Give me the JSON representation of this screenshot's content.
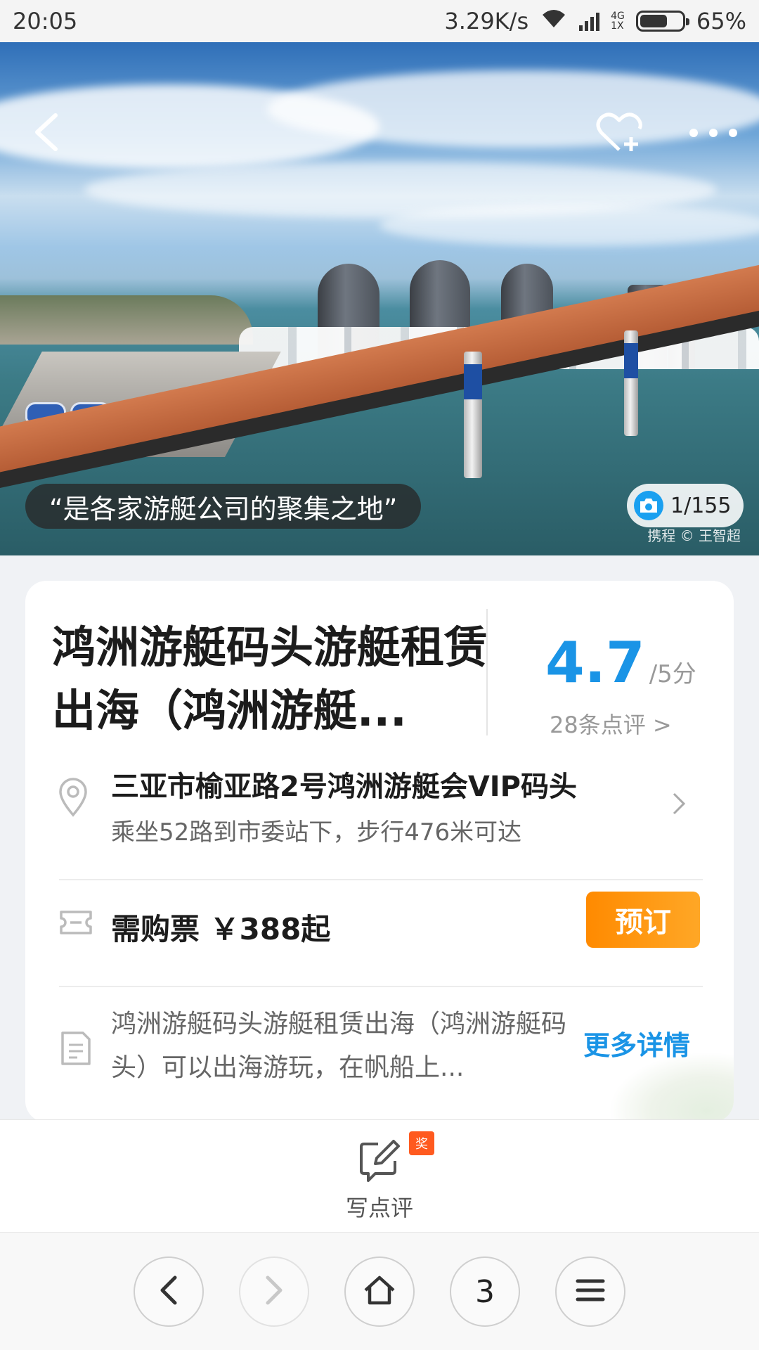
{
  "status_bar": {
    "time": "20:05",
    "speed": "3.29K/s",
    "net_top": "4G",
    "net_bottom": "1X",
    "battery": "65%"
  },
  "hero": {
    "caption": "“是各家游艇公司的聚集之地”",
    "photo_counter": "1/155",
    "watermark": "携程 © 王智超"
  },
  "poi": {
    "title": "鸿洲游艇码头游艇租赁出海（鸿洲游艇...",
    "score": "4.7",
    "score_unit": "/5分",
    "reviews_link": "28条点评 >",
    "address": "三亚市榆亚路2号鸿洲游艇会VIP码头",
    "transport": "乘坐52路到市委站下，步行476米可达",
    "ticket": "需购票 ￥388起",
    "book_button": "预订",
    "description": "鸿洲游艇码头游艇租赁出海（鸿洲游艇码头）可以出海游玩，在帆船上...",
    "more_details": "更多详情"
  },
  "review_bar": {
    "badge": "奖",
    "label": "写点评"
  },
  "browser_bar": {
    "tab_count": "3"
  },
  "colors": {
    "accent_blue": "#1a94e6",
    "book_orange": "#ff8a00",
    "badge_orange": "#ff5a1f"
  },
  "icons": [
    "back-icon",
    "favorite-add-icon",
    "more-icon",
    "camera-icon",
    "location-pin-icon",
    "chevron-right-icon",
    "ticket-icon",
    "document-icon",
    "edit-review-icon",
    "browser-back-icon",
    "browser-forward-icon",
    "home-icon",
    "menu-icon"
  ]
}
